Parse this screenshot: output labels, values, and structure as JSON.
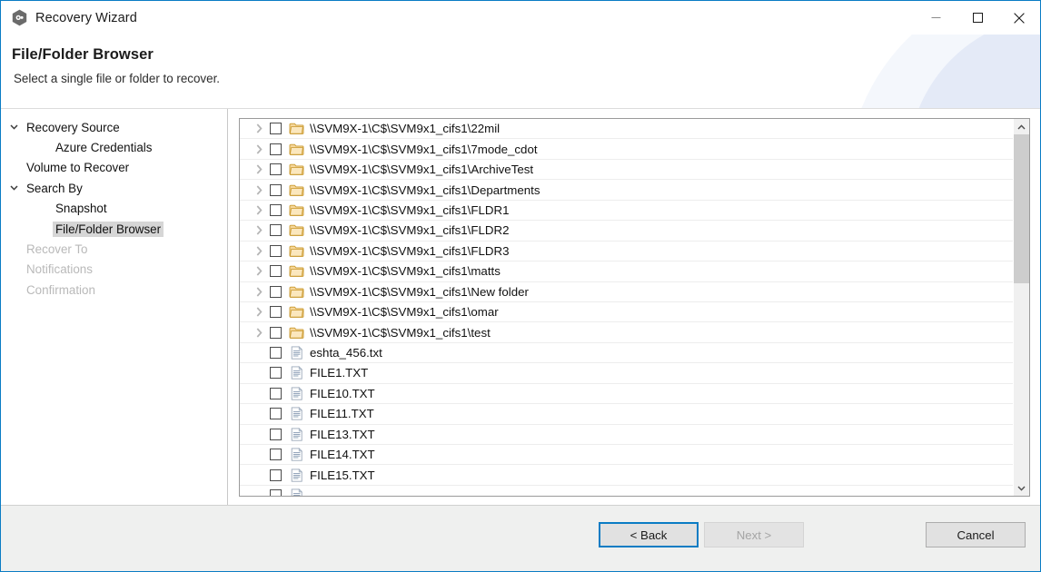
{
  "window": {
    "title": "Recovery Wizard",
    "icon": "hexagon-app-icon",
    "border_color": "#0a7cc4",
    "controls": {
      "minimize": "minimize-icon",
      "maximize": "maximize-icon",
      "close": "close-icon"
    }
  },
  "header": {
    "title": "File/Folder Browser",
    "subtitle": "Select a single file or folder to recover."
  },
  "sidebar": {
    "items": [
      {
        "label": "Recovery Source",
        "level": 0,
        "expander": "chevron-down-icon",
        "state": "normal",
        "selected": false
      },
      {
        "label": "Azure Credentials",
        "level": 1,
        "expander": "",
        "state": "normal",
        "selected": false
      },
      {
        "label": "Volume to Recover",
        "level": 0,
        "expander": "",
        "state": "normal",
        "selected": false
      },
      {
        "label": "Search By",
        "level": 0,
        "expander": "chevron-down-icon",
        "state": "normal",
        "selected": false
      },
      {
        "label": "Snapshot",
        "level": 1,
        "expander": "",
        "state": "normal",
        "selected": false
      },
      {
        "label": "File/Folder Browser",
        "level": 1,
        "expander": "",
        "state": "normal",
        "selected": true
      },
      {
        "label": "Recover To",
        "level": 0,
        "expander": "",
        "state": "disabled",
        "selected": false
      },
      {
        "label": "Notifications",
        "level": 0,
        "expander": "",
        "state": "disabled",
        "selected": false
      },
      {
        "label": "Confirmation",
        "level": 0,
        "expander": "",
        "state": "disabled",
        "selected": false
      }
    ]
  },
  "tree": {
    "rows": [
      {
        "label": "\\\\SVM9X-1\\C$\\SVM9x1_cifs1\\22mil",
        "type": "folder",
        "expandable": true,
        "checked": false
      },
      {
        "label": "\\\\SVM9X-1\\C$\\SVM9x1_cifs1\\7mode_cdot",
        "type": "folder",
        "expandable": true,
        "checked": false
      },
      {
        "label": "\\\\SVM9X-1\\C$\\SVM9x1_cifs1\\ArchiveTest",
        "type": "folder",
        "expandable": true,
        "checked": false
      },
      {
        "label": "\\\\SVM9X-1\\C$\\SVM9x1_cifs1\\Departments",
        "type": "folder",
        "expandable": true,
        "checked": false
      },
      {
        "label": "\\\\SVM9X-1\\C$\\SVM9x1_cifs1\\FLDR1",
        "type": "folder",
        "expandable": true,
        "checked": false
      },
      {
        "label": "\\\\SVM9X-1\\C$\\SVM9x1_cifs1\\FLDR2",
        "type": "folder",
        "expandable": true,
        "checked": false
      },
      {
        "label": "\\\\SVM9X-1\\C$\\SVM9x1_cifs1\\FLDR3",
        "type": "folder",
        "expandable": true,
        "checked": false
      },
      {
        "label": "\\\\SVM9X-1\\C$\\SVM9x1_cifs1\\matts",
        "type": "folder",
        "expandable": true,
        "checked": false
      },
      {
        "label": "\\\\SVM9X-1\\C$\\SVM9x1_cifs1\\New folder",
        "type": "folder",
        "expandable": true,
        "checked": false
      },
      {
        "label": "\\\\SVM9X-1\\C$\\SVM9x1_cifs1\\omar",
        "type": "folder",
        "expandable": true,
        "checked": false
      },
      {
        "label": "\\\\SVM9X-1\\C$\\SVM9x1_cifs1\\test",
        "type": "folder",
        "expandable": true,
        "checked": false
      },
      {
        "label": "eshta_456.txt",
        "type": "file",
        "expandable": false,
        "checked": false
      },
      {
        "label": "FILE1.TXT",
        "type": "file",
        "expandable": false,
        "checked": false
      },
      {
        "label": "FILE10.TXT",
        "type": "file",
        "expandable": false,
        "checked": false
      },
      {
        "label": "FILE11.TXT",
        "type": "file",
        "expandable": false,
        "checked": false
      },
      {
        "label": "FILE13.TXT",
        "type": "file",
        "expandable": false,
        "checked": false
      },
      {
        "label": "FILE14.TXT",
        "type": "file",
        "expandable": false,
        "checked": false
      },
      {
        "label": "FILE15.TXT",
        "type": "file",
        "expandable": false,
        "checked": false
      },
      {
        "label": "",
        "type": "file",
        "expandable": false,
        "checked": false
      }
    ],
    "expander_icon": "chevron-right-icon",
    "folder_icon": "folder-icon",
    "file_icon": "document-icon",
    "scrollbar": {
      "up_icon": "chevron-up-icon",
      "down_icon": "chevron-down-icon",
      "thumb_position": "top"
    }
  },
  "footer": {
    "back_label": "< Back",
    "next_label": "Next >",
    "cancel_label": "Cancel",
    "next_disabled": true,
    "back_focused": true
  }
}
